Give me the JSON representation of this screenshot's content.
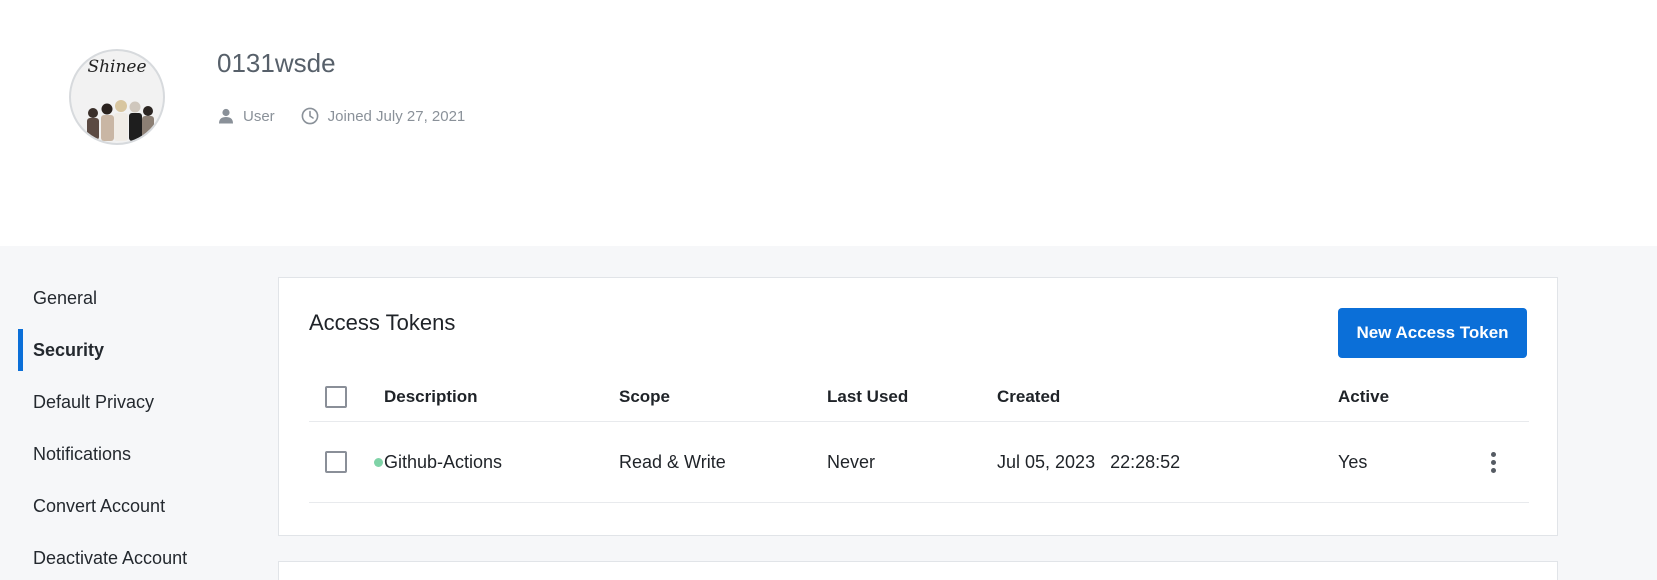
{
  "profile": {
    "username": "0131wsde",
    "role": "User",
    "joined": "Joined July 27, 2021",
    "avatar_text": "Shinee"
  },
  "sidebar": {
    "items": [
      {
        "label": "General",
        "active": false
      },
      {
        "label": "Security",
        "active": true
      },
      {
        "label": "Default Privacy",
        "active": false
      },
      {
        "label": "Notifications",
        "active": false
      },
      {
        "label": "Convert Account",
        "active": false
      },
      {
        "label": "Deactivate Account",
        "active": false
      }
    ]
  },
  "tokens": {
    "title": "Access Tokens",
    "new_button_label": "New Access Token",
    "columns": {
      "description": "Description",
      "scope": "Scope",
      "last_used": "Last Used",
      "created": "Created",
      "active": "Active"
    },
    "rows": [
      {
        "description": "Github-Actions",
        "scope": "Read & Write",
        "last_used": "Never",
        "created_date": "Jul 05, 2023",
        "created_time": "22:28:52",
        "active": "Yes"
      }
    ]
  },
  "colors": {
    "accent": "#0b6fd8",
    "status_active": "#7fd3a7",
    "page_background": "#f6f7f9"
  },
  "icons": {
    "role": "user-icon",
    "joined": "clock-icon",
    "row_menu": "kebab-menu-icon"
  }
}
